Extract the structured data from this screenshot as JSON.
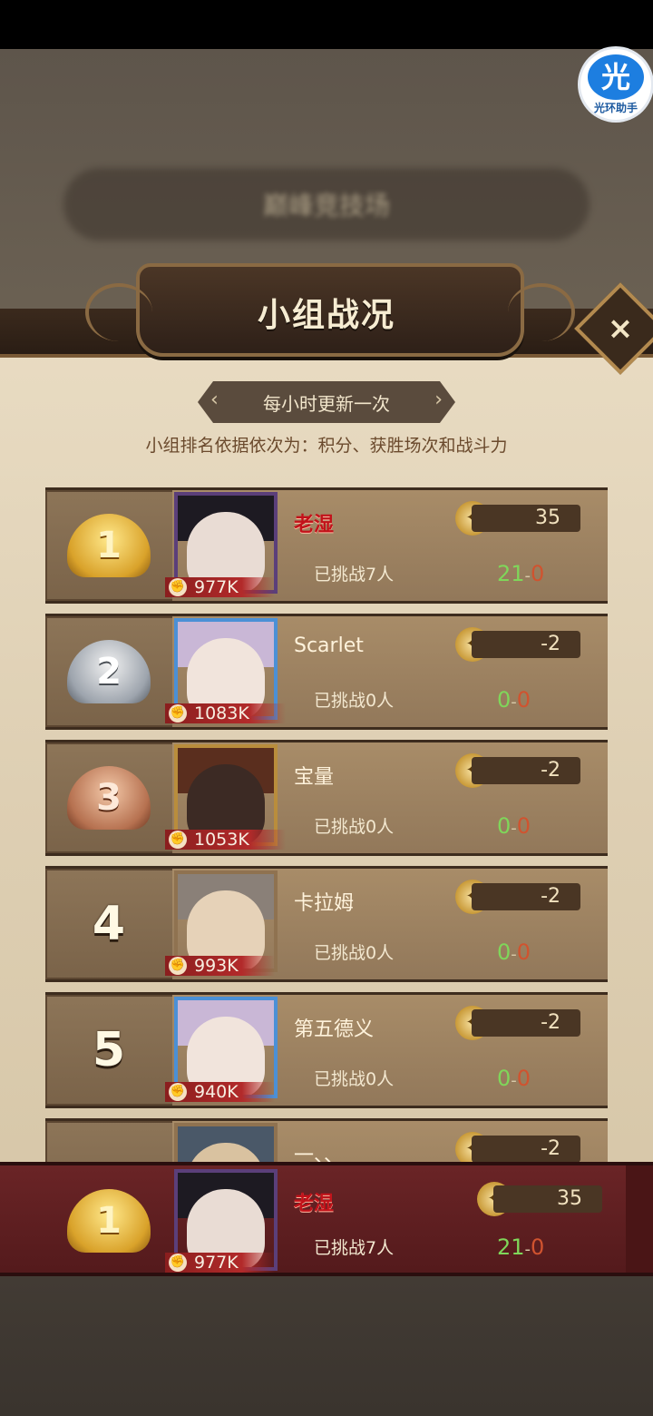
{
  "helper": {
    "glyph": "光",
    "label": "光环助手"
  },
  "background_title": "巅峰竞技场",
  "header": {
    "title": "小组战况",
    "close": "×"
  },
  "update_notice": "每小时更新一次",
  "ranking_rule": "小组排名依据依次为：积分、获胜场次和战斗力",
  "rows": [
    {
      "rank": "1",
      "name": "老湿",
      "power": "977K",
      "challenged": "已挑战7人",
      "score": "35",
      "wins": "21",
      "losses": "0"
    },
    {
      "rank": "2",
      "name": "Scarlet",
      "power": "1083K",
      "challenged": "已挑战0人",
      "score": "-2",
      "wins": "0",
      "losses": "0"
    },
    {
      "rank": "3",
      "name": "宝量",
      "power": "1053K",
      "challenged": "已挑战0人",
      "score": "-2",
      "wins": "0",
      "losses": "0"
    },
    {
      "rank": "4",
      "name": "卡拉姆",
      "power": "993K",
      "challenged": "已挑战0人",
      "score": "-2",
      "wins": "0",
      "losses": "0"
    },
    {
      "rank": "5",
      "name": "第五德义",
      "power": "940K",
      "challenged": "已挑战0人",
      "score": "-2",
      "wins": "0",
      "losses": "0"
    },
    {
      "rank": "",
      "name": "一、、",
      "power": "",
      "challenged": "",
      "score": "-2",
      "wins": "",
      "losses": ""
    }
  ],
  "me": {
    "rank": "1",
    "name": "老湿",
    "power": "977K",
    "challenged": "已挑战7人",
    "score": "35",
    "wins": "21",
    "losses": "0"
  },
  "separator": "-",
  "colors": {
    "gold": "#d9a22a",
    "silver": "#9da4ad",
    "bronze": "#b67150",
    "highlight_name": "#c2121a",
    "win": "#7fd65a",
    "loss": "#d0532f"
  }
}
